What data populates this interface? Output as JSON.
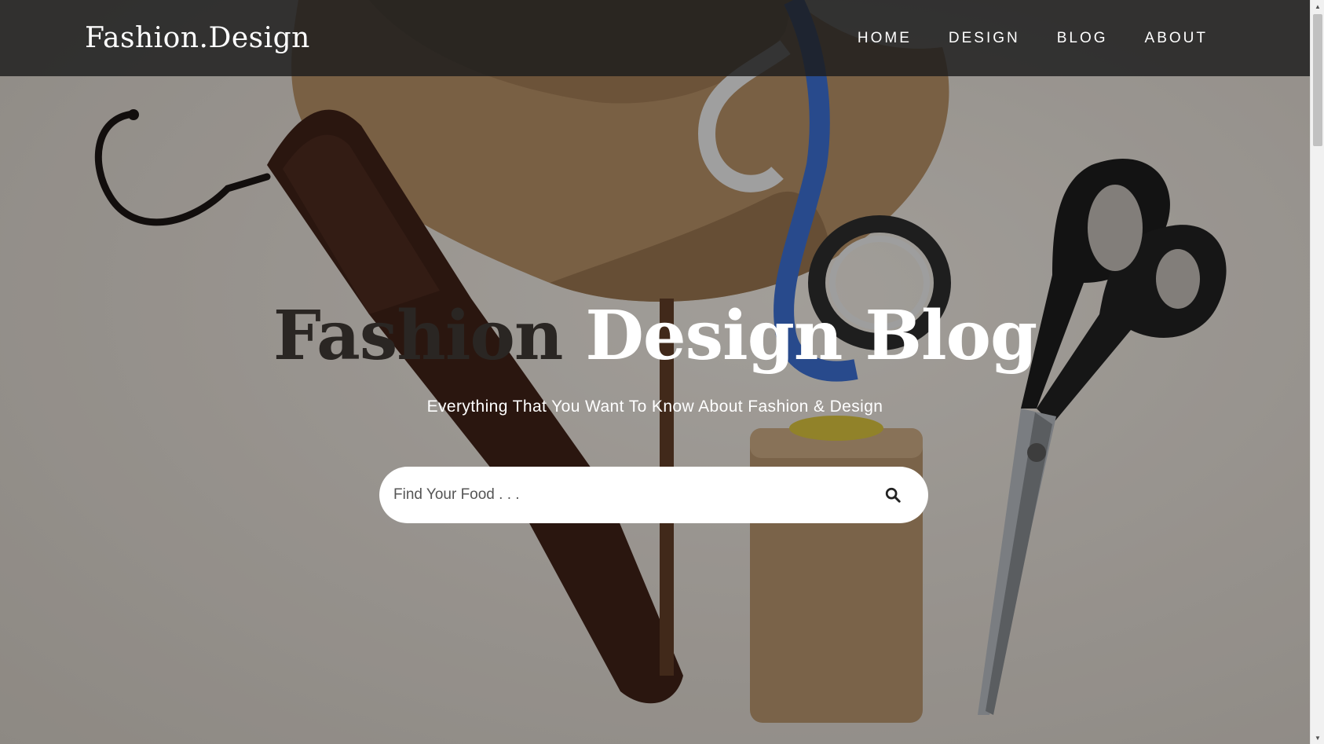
{
  "header": {
    "brand": "Fashion.Design",
    "nav": [
      "HOME",
      "DESIGN",
      "BLOG",
      "ABOUT"
    ]
  },
  "hero": {
    "title_dark": "Fashion",
    "title_light": "Design Blog",
    "subtitle": "Everything That You Want To Know About Fashion & Design",
    "search_placeholder": "Find Your Food . . ."
  },
  "icons": {
    "search": "search-icon",
    "scroll_up": "chevron-up-icon",
    "scroll_down": "chevron-down-icon"
  },
  "colors": {
    "navbar": "#1c1c1c",
    "title_dark": "#2a2623",
    "text_light": "#ffffff"
  }
}
